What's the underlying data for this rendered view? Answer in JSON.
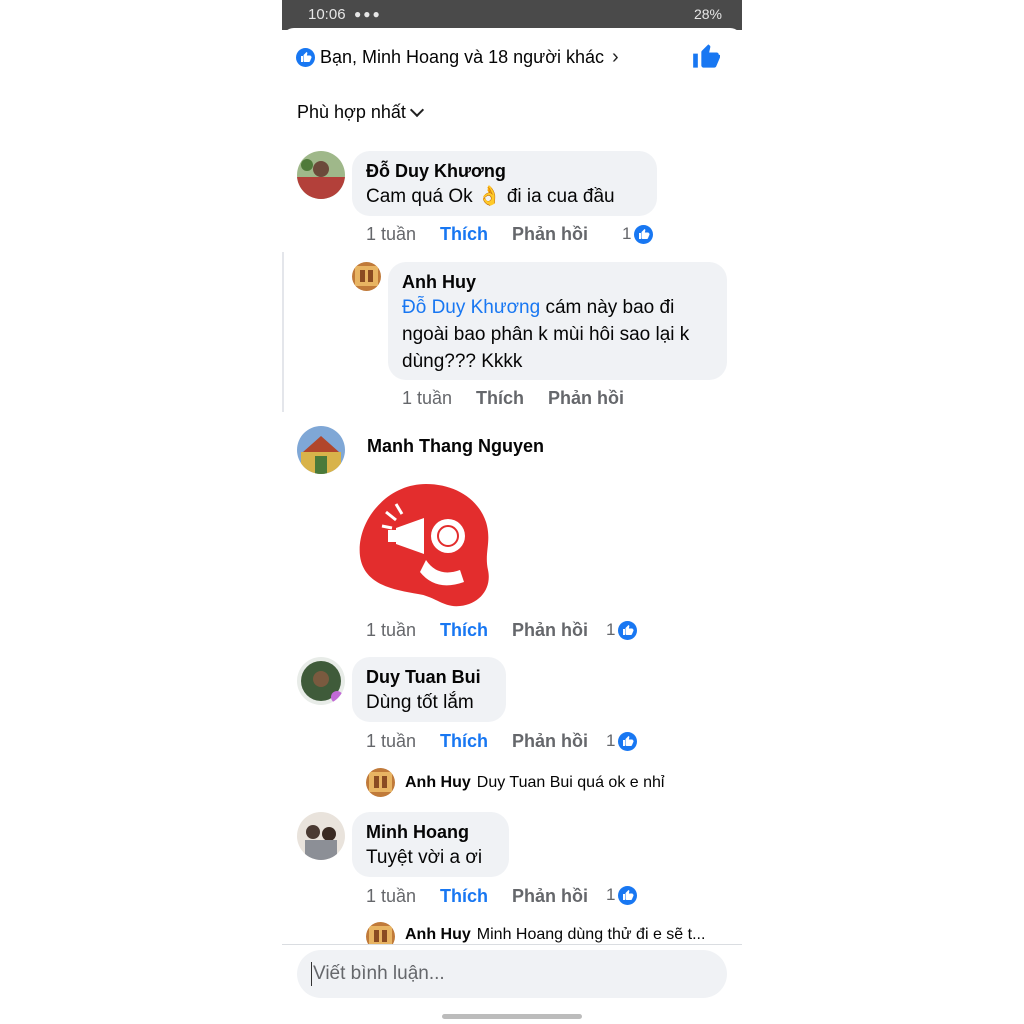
{
  "status": {
    "time": "10:06",
    "right": "28%"
  },
  "header": {
    "reactions_text": "Bạn, Minh Hoang và 18 người khác"
  },
  "sort": {
    "label": "Phù hợp nhất"
  },
  "comments": [
    {
      "name": "Đỗ Duy Khương",
      "text": "Cam quá Ok 👌 đi ia cua đầu",
      "time": "1 tuần",
      "like": "Thích",
      "reply": "Phản hồi",
      "reactions": "1"
    },
    {
      "name": "Manh Thang Nguyen",
      "time": "1 tuần",
      "like": "Thích",
      "reply": "Phản hồi",
      "reactions": "1"
    },
    {
      "name": "Duy Tuan Bui",
      "text": "Dùng tốt lắm",
      "time": "1 tuần",
      "like": "Thích",
      "reply": "Phản hồi",
      "reactions": "1"
    },
    {
      "name": "Minh Hoang",
      "text": "Tuyệt vời a ơi",
      "time": "1 tuần",
      "like": "Thích",
      "reply": "Phản hồi",
      "reactions": "1"
    }
  ],
  "replies": [
    {
      "name": "Anh Huy",
      "mention": "Đỗ Duy Khương",
      "text": " cám này bao đi ngoài bao phân k mùi hôi sao lại k dùng??? Kkkk",
      "time": "1 tuần",
      "like": "Thích",
      "reply": "Phản hồi"
    }
  ],
  "reply_previews": [
    {
      "name": "Anh Huy",
      "text": "Duy Tuan Bui quá ok e nhỉ"
    },
    {
      "name": "Anh Huy",
      "text": "Minh Hoang dùng thử đi e sẽ t..."
    }
  ],
  "composer": {
    "placeholder": "Viết bình luận..."
  },
  "colors": {
    "accent": "#1877f2",
    "bubble": "#f0f2f5",
    "sticker": "#e32d2d"
  }
}
